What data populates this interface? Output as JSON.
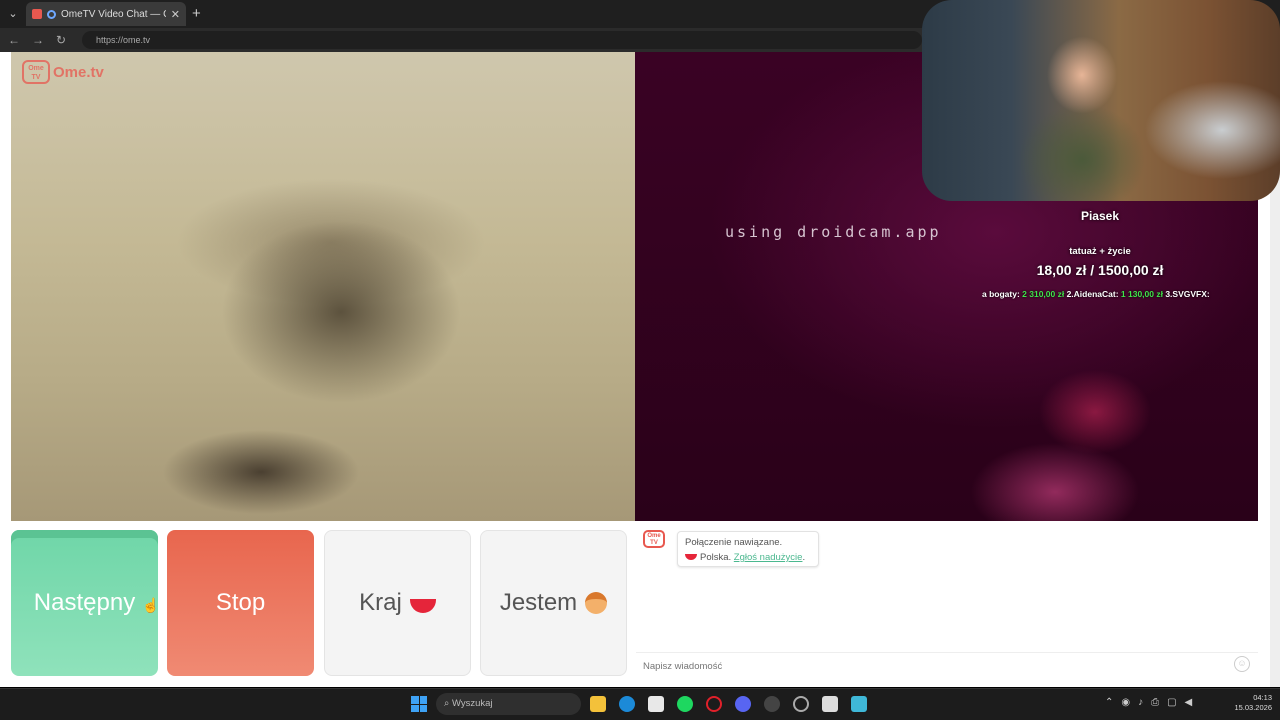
{
  "browser": {
    "tab_title": "OmeTV Video Chat — Omegl",
    "tab_close": "✕",
    "new_tab": "+",
    "url": "https://ome.tv"
  },
  "site": {
    "logo_box": "Ome TV",
    "logo_text": "Ome.tv",
    "watermark": "using droidcam.app"
  },
  "controls": {
    "next_label": "Następny",
    "stop_label": "Stop",
    "country_label": "Kraj",
    "gender_label": "Jestem"
  },
  "chat": {
    "logo": "Ome TV",
    "status_line": "Połączenie nawiązane.",
    "country": "Polska.",
    "report_link": "Zgłoś nadużycie",
    "report_suffix": ".",
    "input_placeholder": "Napisz wiadomość"
  },
  "stream_overlay": {
    "streamer_name": "Piasek",
    "goal_title": "tatuaż + życie",
    "goal_amount": "18,00 zł / 1500,00 zł",
    "ticker_prefix": "a bogaty: ",
    "ticker_amount1": "2 310,00 zł",
    "ticker_mid": "  2.AidenaCat: ",
    "ticker_amount2": "1 130,00 zł",
    "ticker_suffix": "  3.SVGVFX:"
  },
  "taskbar": {
    "search_placeholder": "Wyszukaj",
    "time": "04:13",
    "date": "15.03.2026"
  },
  "colors": {
    "next": "#6fd6a8",
    "stop": "#e8664e",
    "accent": "#e8584f"
  }
}
